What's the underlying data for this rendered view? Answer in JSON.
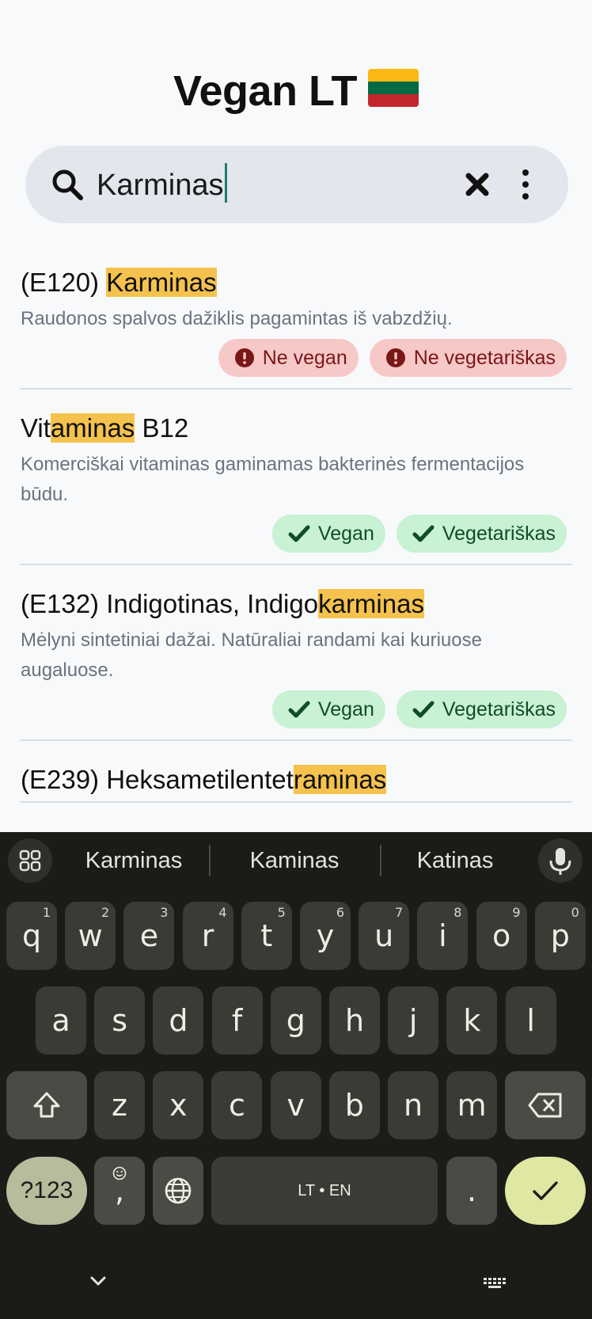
{
  "app": {
    "title": "Vegan LT"
  },
  "colors": {
    "highlight": "#f4c24d",
    "not_vegan_bg": "#f6c8c8",
    "vegan_bg": "#c9f1d4",
    "caret": "#1c7c74"
  },
  "search": {
    "value": "Karminas"
  },
  "results": [
    {
      "title_parts": [
        {
          "t": "(E120) ",
          "h": false
        },
        {
          "t": "Karminas",
          "h": true
        }
      ],
      "description": "Raudonos spalvos dažiklis pagamintas iš vabzdžių.",
      "badges": [
        {
          "label": "Ne vegan",
          "type": "bad",
          "icon": "alert-icon"
        },
        {
          "label": "Ne vegetariškas",
          "type": "bad",
          "icon": "alert-icon"
        }
      ]
    },
    {
      "title_parts": [
        {
          "t": "Vit",
          "h": false
        },
        {
          "t": "aminas",
          "h": true
        },
        {
          "t": " B12",
          "h": false
        }
      ],
      "description": "Komerciškai vitaminas gaminamas bakterinės fermentacijos būdu.",
      "badges": [
        {
          "label": "Vegan",
          "type": "good",
          "icon": "check-icon"
        },
        {
          "label": "Vegetariškas",
          "type": "good",
          "icon": "check-icon"
        }
      ]
    },
    {
      "title_parts": [
        {
          "t": "(E132) Indigotinas, Indigo",
          "h": false
        },
        {
          "t": "karminas",
          "h": true
        }
      ],
      "description": "Mėlyni sintetiniai dažai. Natūraliai randami kai kuriuose augaluose.",
      "badges": [
        {
          "label": "Vegan",
          "type": "good",
          "icon": "check-icon"
        },
        {
          "label": "Vegetariškas",
          "type": "good",
          "icon": "check-icon"
        }
      ]
    },
    {
      "title_parts": [
        {
          "t": "(E239) Heksametilentet",
          "h": false
        },
        {
          "t": "raminas",
          "h": true
        }
      ],
      "description": "",
      "badges": []
    }
  ],
  "keyboard": {
    "suggestions": [
      "Karminas",
      "Kaminas",
      "Katinas"
    ],
    "row1": [
      [
        "q",
        "1"
      ],
      [
        "w",
        "2"
      ],
      [
        "e",
        "3"
      ],
      [
        "r",
        "4"
      ],
      [
        "t",
        "5"
      ],
      [
        "y",
        "6"
      ],
      [
        "u",
        "7"
      ],
      [
        "i",
        "8"
      ],
      [
        "o",
        "9"
      ],
      [
        "p",
        "0"
      ]
    ],
    "row2": [
      "a",
      "s",
      "d",
      "f",
      "g",
      "h",
      "j",
      "k",
      "l"
    ],
    "row3": [
      "z",
      "x",
      "c",
      "v",
      "b",
      "n",
      "m"
    ],
    "symbols_label": "?123",
    "comma_label": ",",
    "space_label": "LT • EN",
    "period_label": "."
  }
}
